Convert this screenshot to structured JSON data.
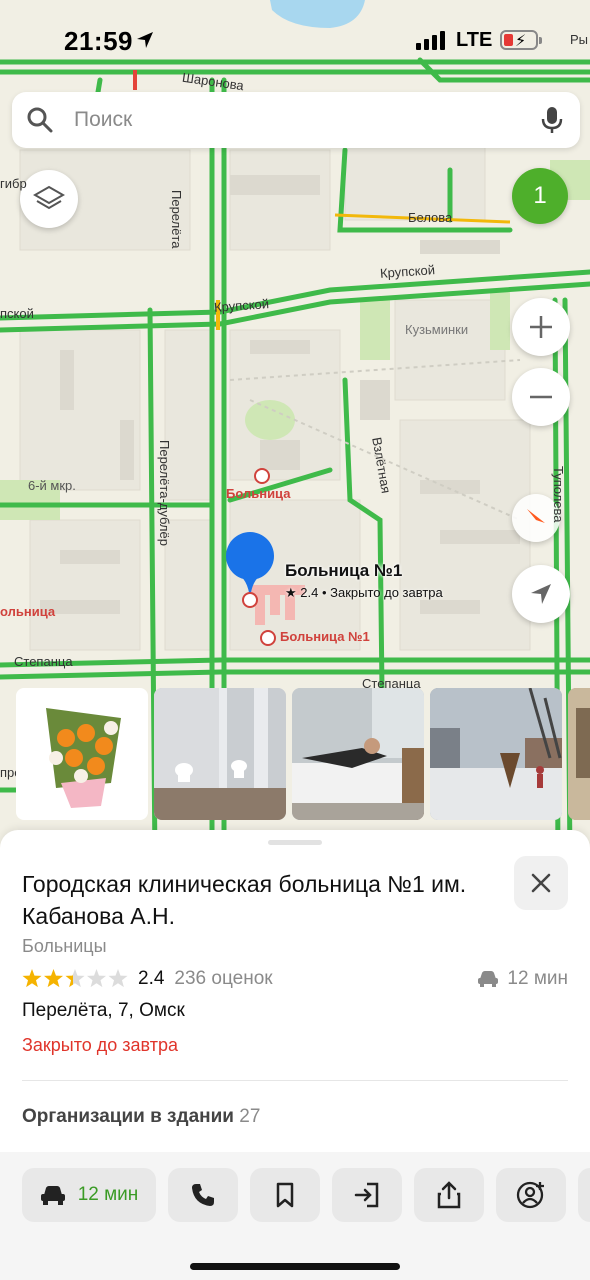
{
  "status_bar": {
    "time": "21:59",
    "network": "LTE"
  },
  "search": {
    "placeholder": "Поиск"
  },
  "map": {
    "traffic_badge": "1",
    "street_labels": {
      "sharonova": "Шаронова",
      "belova": "Белова",
      "krupskoy_right": "Крупской",
      "krupskoy_center": "Крупской",
      "krupskoy_left": "пской",
      "pereleta": "Перелёта",
      "pereleta_dubler": "Перелёта-дублёр",
      "vzletnaya": "Взлётная",
      "tupoleva": "Туполева",
      "stepantsa_left": "Степанца",
      "stepantsa_right": "Степанца",
      "kuzminki": "Кузьминки",
      "mkr6": "6-й мкр.",
      "top_right": "Ры",
      "gibr": "гибр",
      "pre": "пре"
    },
    "poi": {
      "hospital_1": "Больница",
      "hospital_2": "Больница №1",
      "hospital_left": "ольница"
    },
    "selected_pin": {
      "title": "Больница №1",
      "subtitle": "★ 2.4 • Закрыто до завтра"
    }
  },
  "photos": [
    {
      "name": "bouquet-photo"
    },
    {
      "name": "restroom-photo"
    },
    {
      "name": "ward-photo"
    },
    {
      "name": "street-photo"
    },
    {
      "name": "corridor-photo"
    }
  ],
  "card": {
    "title": "Городская клиническая больница №1 им. Кабанова А.Н.",
    "category": "Больницы",
    "rating": "2.4",
    "rating_fraction": 0.48,
    "reviews": "236 оценок",
    "eta": "12 мин",
    "address": "Перелёта, 7, Омск",
    "status": "Закрыто до завтра",
    "orgs_label": "Организации в здании",
    "orgs_count": "27"
  },
  "actions": {
    "route_eta": "12 мин"
  },
  "colors": {
    "traffic_green": "#3fba4a",
    "accent_green": "#4eaf2b",
    "pin_blue": "#1a73e8",
    "closed_red": "#e0352b",
    "star_gold": "#f5b300"
  }
}
